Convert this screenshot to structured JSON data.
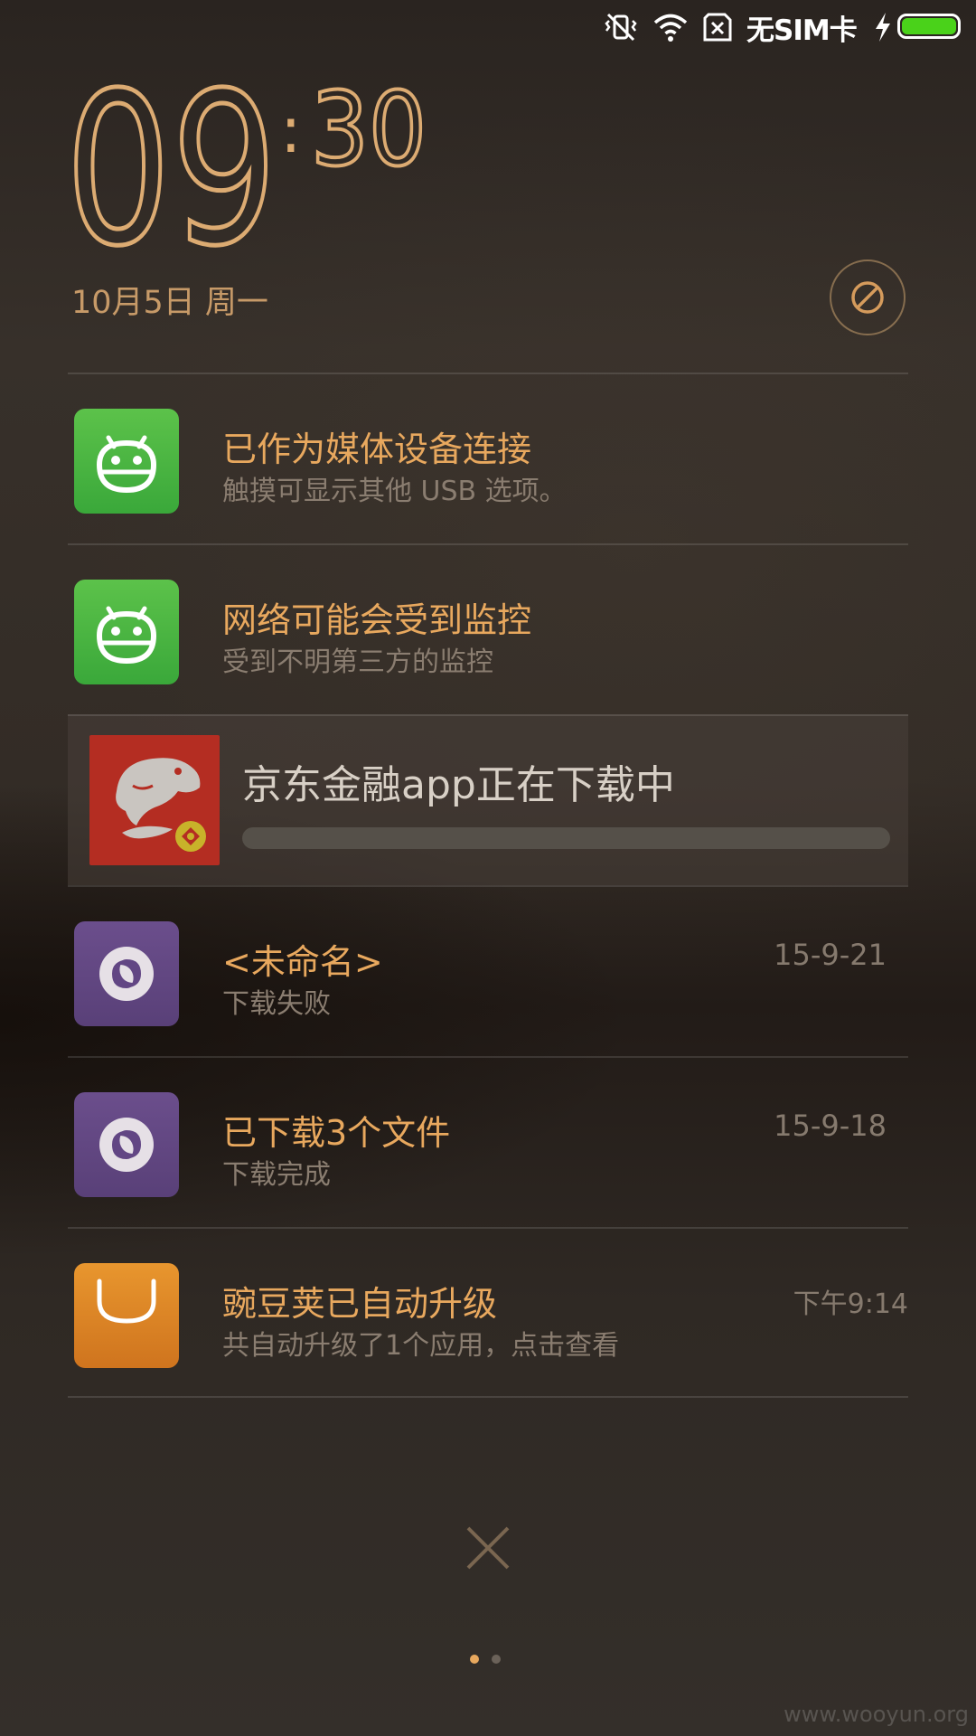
{
  "status_bar": {
    "icons": [
      "vibrate-mute-icon",
      "wifi-icon",
      "no-sim-icon",
      "charging-bolt-icon",
      "battery-icon"
    ],
    "carrier_text": "无SIM卡",
    "battery_level": 1.0,
    "battery_color": "#4ad21a"
  },
  "lockscreen": {
    "clock_hours": "09",
    "clock_minutes": "30",
    "clock_color": "#dcab72",
    "date": "10月5日 周一",
    "dnd_icon": "do-not-disturb-icon"
  },
  "notifications": [
    {
      "icon": "android-robot-icon",
      "icon_color": "#4fb944",
      "title": "已作为媒体设备连接",
      "text": "触摸可显示其他 USB 选项。"
    },
    {
      "icon": "android-robot-icon",
      "icon_color": "#4fb944",
      "title": "网络可能会受到监控",
      "text": "受到不明第三方的监控"
    },
    {
      "icon": "jd-finance-logo",
      "icon_color": "#b42d22",
      "title": "京东金融app正在下载中",
      "progress": 0.0
    },
    {
      "icon": "download-manager-icon",
      "icon_color": "#624684",
      "title": "<未命名>",
      "text": "下载失败",
      "time": "15-9-21"
    },
    {
      "icon": "download-manager-icon",
      "icon_color": "#624684",
      "title": "已下载3个文件",
      "text": "下载完成",
      "time": "15-9-18"
    },
    {
      "icon": "wandoujia-bag-icon",
      "icon_color": "#dd8428",
      "title": "豌豆荚已自动升级",
      "text": "共自动升级了1个应用，点击查看",
      "time": "下午9:14"
    }
  ],
  "controls": {
    "clear_icon": "close-icon",
    "page_count": 2,
    "active_page": 1
  },
  "watermark": "www.wooyun.org"
}
